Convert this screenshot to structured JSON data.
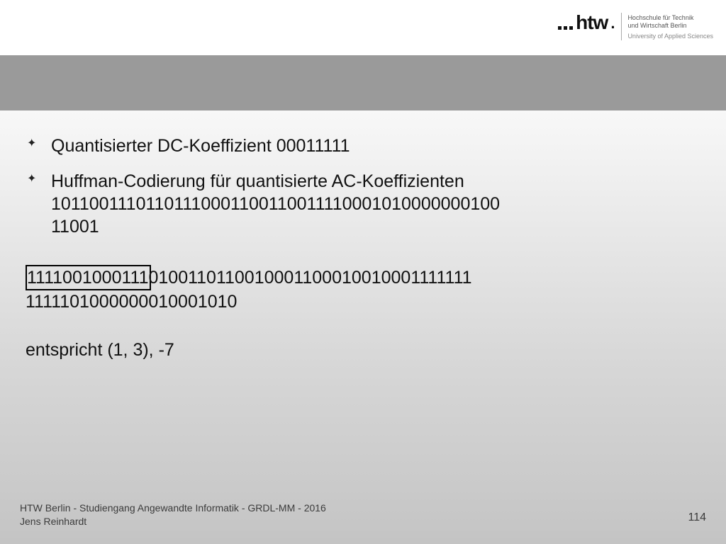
{
  "logo": {
    "mark": "htw",
    "sub_line1": "Hochschule für Technik",
    "sub_line2": "und Wirtschaft Berlin",
    "sub_line3": "University of Applied Sciences"
  },
  "bullets": [
    {
      "text": "Quantisierter DC-Koeffizient 00011111"
    },
    {
      "line1": "Huffman-Codierung für quantisierte AC-Koeffizienten",
      "line2": "10110011101101110001100110011110001010000000100",
      "line3": "11001"
    }
  ],
  "block": {
    "boxed": "1111001000111",
    "rest1": "0100110110010001100010010001111111",
    "line2": "1111101000000010001010"
  },
  "corresp": "entspricht (1, 3), -7",
  "footer": {
    "line1": "HTW Berlin - Studiengang Angewandte Informatik - GRDL-MM - 2016",
    "line2": "Jens Reinhardt",
    "page": "114"
  }
}
